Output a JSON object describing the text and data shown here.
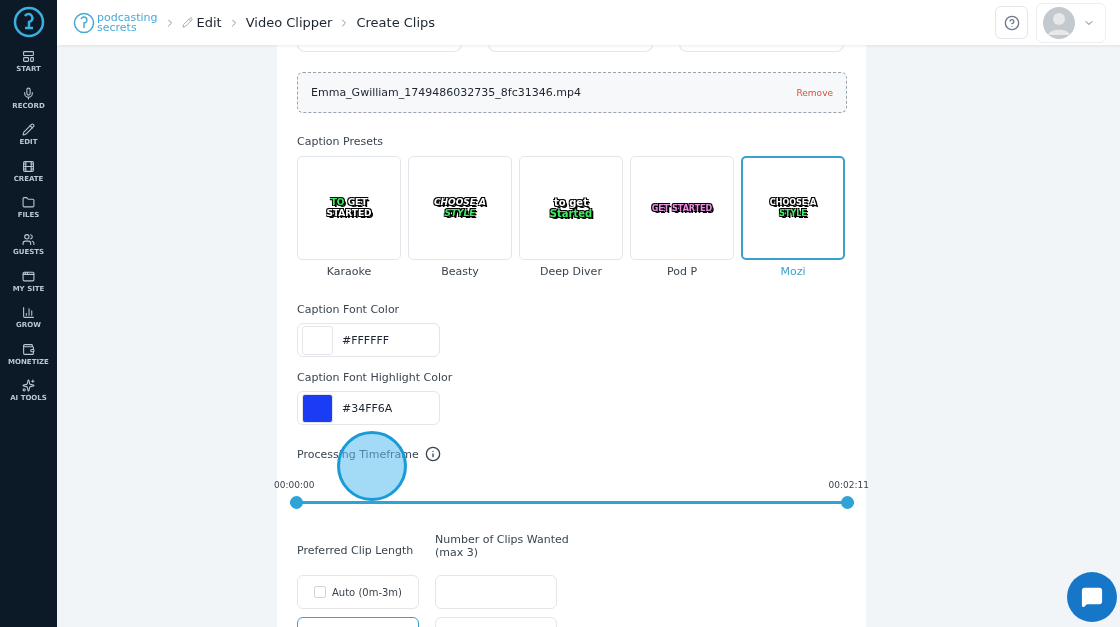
{
  "sidebar": {
    "items": [
      {
        "label": "START",
        "kind": "start"
      },
      {
        "label": "RECORD",
        "kind": "record"
      },
      {
        "label": "EDIT",
        "kind": "edit"
      },
      {
        "label": "CREATE",
        "kind": "create"
      },
      {
        "label": "FILES",
        "kind": "files"
      },
      {
        "label": "GUESTS",
        "kind": "guests"
      },
      {
        "label": "MY SITE",
        "kind": "site"
      },
      {
        "label": "GROW",
        "kind": "grow"
      },
      {
        "label": "MONETIZE",
        "kind": "monetize"
      },
      {
        "label": "AI TOOLS",
        "kind": "ai"
      }
    ]
  },
  "header": {
    "brand": [
      "podcasting",
      "secrets"
    ],
    "breadcrumb": [
      "Edit",
      "Video Clipper",
      "Create Clips"
    ]
  },
  "file": {
    "name": "Emma_Gwilliam_1749486032735_8fc31346.mp4",
    "action": "Remove"
  },
  "caption_presets": {
    "label": "Caption Presets",
    "items": [
      {
        "name": "Karaoke",
        "selected": false,
        "kind": "karaoke",
        "preview": [
          [
            {
              "text": "TO",
              "highlight": true
            },
            {
              "text": "GET",
              "highlight": false
            }
          ],
          [
            {
              "text": "STARTED",
              "highlight": false
            }
          ]
        ]
      },
      {
        "name": "Beasty",
        "selected": false,
        "kind": "beasty",
        "preview": [
          [
            {
              "text": "CHOOSE A",
              "highlight": false
            }
          ],
          [
            {
              "text": "STYLE",
              "highlight": true
            }
          ]
        ]
      },
      {
        "name": "Deep Diver",
        "selected": false,
        "kind": "deepdiver",
        "preview": [
          [
            {
              "text": "to get",
              "highlight": false
            }
          ],
          [
            {
              "text": "Started",
              "highlight": true
            }
          ]
        ]
      },
      {
        "name": "Pod P",
        "selected": false,
        "kind": "podp",
        "preview": [
          [
            {
              "text": "GET STARTED",
              "highlight": true
            }
          ]
        ]
      },
      {
        "name": "Mozi",
        "selected": true,
        "kind": "mozi",
        "preview": [
          [
            {
              "text": "CHOOSE A",
              "highlight": false
            }
          ],
          [
            {
              "text": "STYLE",
              "highlight": true
            }
          ]
        ]
      }
    ]
  },
  "font_color": {
    "label": "Caption Font Color",
    "value": "#FFFFFF",
    "color": "#ffffff"
  },
  "highlight_color": {
    "label": "Caption Font Highlight Color",
    "value": "#34FF6A",
    "color": "#1a3cf5"
  },
  "timeframe": {
    "label": "Processing Timeframe",
    "start": {
      "label": "00:00:00",
      "level": 0
    },
    "end": {
      "label": "00:02:11",
      "level": 1
    }
  },
  "clip_length": {
    "label": "Preferred Clip Length",
    "options": [
      {
        "kind": "checkbox",
        "label": "Auto (0m-3m)",
        "checked": false
      },
      {
        "kind": "blank",
        "selected": true
      }
    ]
  },
  "clips_wanted": {
    "label": "Number of Clips Wanted (max 3)"
  }
}
